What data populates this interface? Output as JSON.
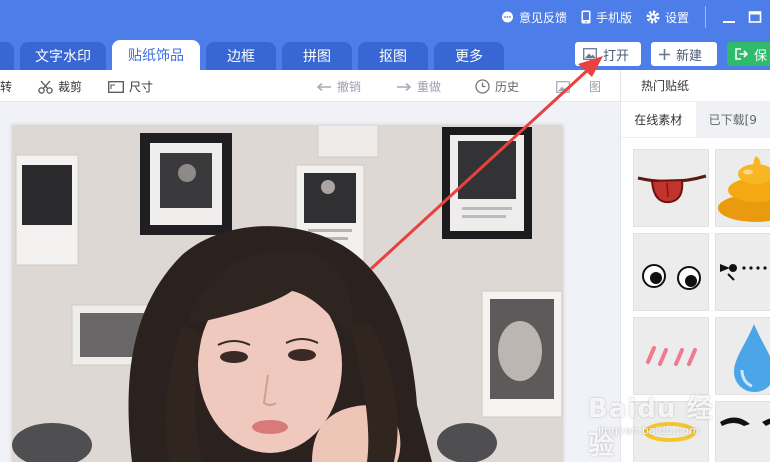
{
  "header": {
    "links": [
      {
        "label": "意见反馈",
        "icon": "chat-bubble-icon"
      },
      {
        "label": "手机版",
        "icon": "phone-icon"
      },
      {
        "label": "设置",
        "icon": "gear-icon"
      }
    ],
    "window_controls": [
      "minimize-icon",
      "maximize-icon"
    ]
  },
  "tabs": [
    {
      "label": ""
    },
    {
      "label": "文字水印"
    },
    {
      "label": "贴纸饰品",
      "active": true
    },
    {
      "label": "边框"
    },
    {
      "label": "拼图"
    },
    {
      "label": "抠图"
    },
    {
      "label": "更多"
    }
  ],
  "actions": {
    "open_label": "打开",
    "new_label": "新建",
    "save_label": "保"
  },
  "toolbar": {
    "rotate_label": "转",
    "crop_label": "裁剪",
    "size_label": "尺寸",
    "undo_label": "撤销",
    "redo_label": "重做",
    "history_label": "历史",
    "compare_label": "图"
  },
  "panel": {
    "title": "热门贴纸",
    "tabs": [
      {
        "label": "在线素材",
        "active": true
      },
      {
        "label": "已下载[9"
      }
    ],
    "stickers": [
      {
        "name": "tongue-sticker"
      },
      {
        "name": "poop-sticker"
      },
      {
        "name": "googly-eyes-sticker"
      },
      {
        "name": "dotted-line-sticker"
      },
      {
        "name": "blush-lines-sticker"
      },
      {
        "name": "water-drop-sticker"
      },
      {
        "name": "halo-sticker"
      },
      {
        "name": "mustache-sticker"
      }
    ]
  },
  "watermark": {
    "logo": "Baidu 经验",
    "url": "jingyan.baidu.com"
  },
  "colors": {
    "brand_blue": "#4d7de8",
    "tab_blue": "#3867d4",
    "save_green": "#2ebc6a",
    "arrow_red": "#e8413f"
  }
}
